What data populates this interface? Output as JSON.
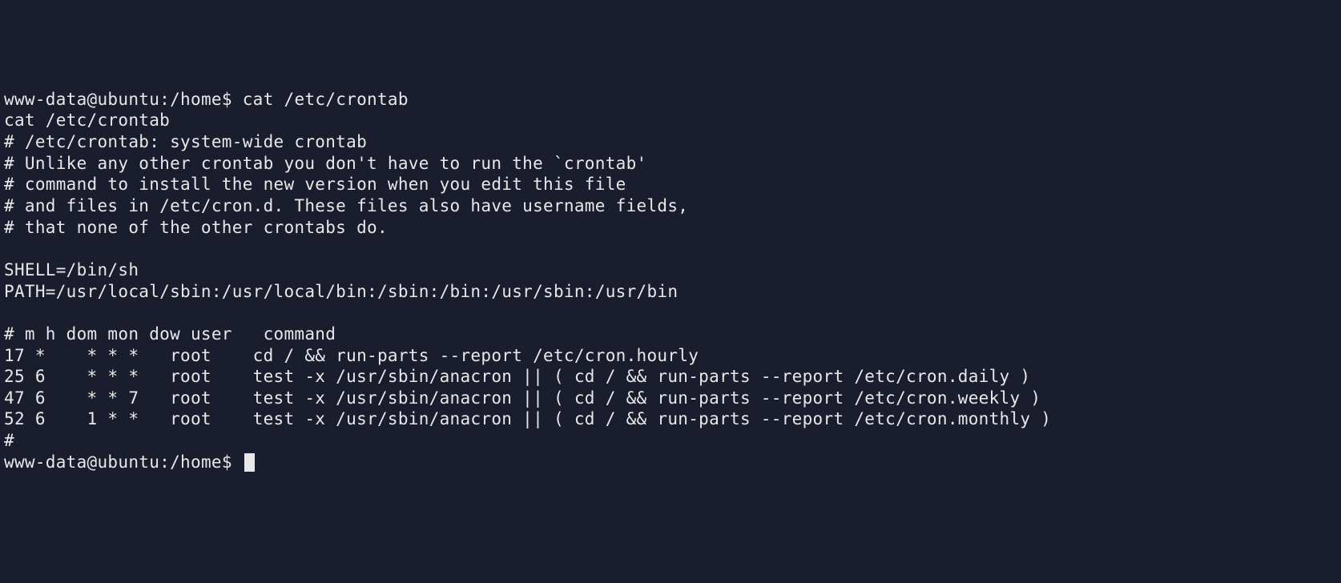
{
  "prompt1": {
    "user_host": "www-data@ubuntu",
    "separator": ":",
    "path": "/home",
    "symbol": "$",
    "command": "cat /etc/crontab"
  },
  "output": {
    "lines": [
      "cat /etc/crontab",
      "# /etc/crontab: system-wide crontab",
      "# Unlike any other crontab you don't have to run the `crontab'",
      "# command to install the new version when you edit this file",
      "# and files in /etc/cron.d. These files also have username fields,",
      "# that none of the other crontabs do.",
      "",
      "SHELL=/bin/sh",
      "PATH=/usr/local/sbin:/usr/local/bin:/sbin:/bin:/usr/sbin:/usr/bin",
      "",
      "# m h dom mon dow user   command",
      "17 *    * * *   root    cd / && run-parts --report /etc/cron.hourly",
      "25 6    * * *   root    test -x /usr/sbin/anacron || ( cd / && run-parts --report /etc/cron.daily )",
      "47 6    * * 7   root    test -x /usr/sbin/anacron || ( cd / && run-parts --report /etc/cron.weekly )",
      "52 6    1 * *   root    test -x /usr/sbin/anacron || ( cd / && run-parts --report /etc/cron.monthly )",
      "#"
    ]
  },
  "prompt2": {
    "user_host": "www-data@ubuntu",
    "separator": ":",
    "path": "/home",
    "symbol": "$"
  }
}
